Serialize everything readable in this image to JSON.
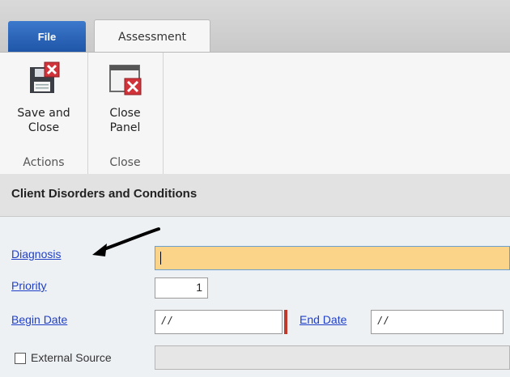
{
  "tabs": {
    "file": "File",
    "assessment": "Assessment"
  },
  "ribbon": {
    "actions": {
      "button_line1": "Save and",
      "button_line2": "Close",
      "group_label": "Actions"
    },
    "close": {
      "button_line1": "Close",
      "button_line2": "Panel",
      "group_label": "Close"
    }
  },
  "section": {
    "title": "Client Disorders and Conditions"
  },
  "form": {
    "diagnosis_label": "Diagnosis",
    "diagnosis_value": "",
    "priority_label": "Priority",
    "priority_value": "1",
    "begin_date_label": "Begin Date",
    "begin_date_value": "/ /",
    "end_date_label": "End Date",
    "end_date_value": "/ /",
    "external_source_label": "External Source",
    "external_source_checked": false
  },
  "colors": {
    "file_tab": "#1f56a8",
    "diagnosis_highlight": "#fbd48a",
    "link": "#1f3fc7",
    "required_marker": "#c0392b"
  },
  "icons": [
    "save-and-close-icon",
    "close-panel-icon",
    "annotation-arrow-icon"
  ]
}
